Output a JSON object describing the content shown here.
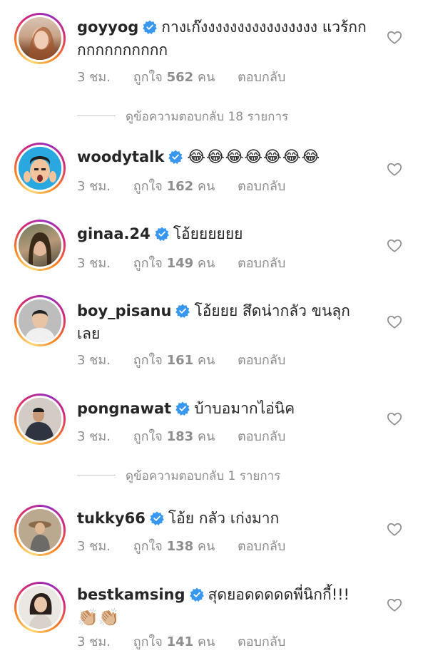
{
  "comments": [
    {
      "username": "goyyog",
      "text": "กางเก๊งงงงงงงงงงงงงงงง แวร้กกกกกกกกกกกก",
      "time": "3 ชม.",
      "likes_prefix": "ถูกใจ",
      "likes": "562",
      "likes_suffix": "คน",
      "reply": "ตอบกลับ"
    },
    {
      "username": "woodytalk",
      "text": "😂😂😂😂😂😂😂",
      "time": "3 ชม.",
      "likes_prefix": "ถูกใจ",
      "likes": "162",
      "likes_suffix": "คน",
      "reply": "ตอบกลับ"
    },
    {
      "username": "ginaa.24",
      "text": "โอ้ยยยยยย",
      "time": "3 ชม.",
      "likes_prefix": "ถูกใจ",
      "likes": "149",
      "likes_suffix": "คน",
      "reply": "ตอบกลับ"
    },
    {
      "username": "boy_pisanu",
      "text": "โอ้ยยย สึดน่ากลัว ขนลุกเลย",
      "time": "3 ชม.",
      "likes_prefix": "ถูกใจ",
      "likes": "161",
      "likes_suffix": "คน",
      "reply": "ตอบกลับ"
    },
    {
      "username": "pongnawat",
      "text": "บ้าบอมากไอ่นิค",
      "time": "3 ชม.",
      "likes_prefix": "ถูกใจ",
      "likes": "183",
      "likes_suffix": "คน",
      "reply": "ตอบกลับ"
    },
    {
      "username": "tukky66",
      "text": "โอ้ย กลัว เก่งมาก",
      "time": "3 ชม.",
      "likes_prefix": "ถูกใจ",
      "likes": "138",
      "likes_suffix": "คน",
      "reply": "ตอบกลับ"
    },
    {
      "username": "bestkamsing",
      "text": "สุดยอดดดดดพี่นิกกี้!!!",
      "text2": "👏🏼👏🏼",
      "time": "3 ชม.",
      "likes_prefix": "ถูกใจ",
      "likes": "141",
      "likes_suffix": "คน",
      "reply": "ตอบกลับ"
    }
  ],
  "view_replies": [
    {
      "label": "ดูข้อความตอบกลับ 18 รายการ"
    },
    {
      "label": "ดูข้อความตอบกลับ 1 รายการ"
    }
  ],
  "colors": {
    "verified": "#3897f0",
    "meta": "#8e8e8e",
    "text": "#262626"
  },
  "icons": {
    "verified": "verified-badge-icon",
    "like": "heart-outline-icon"
  }
}
